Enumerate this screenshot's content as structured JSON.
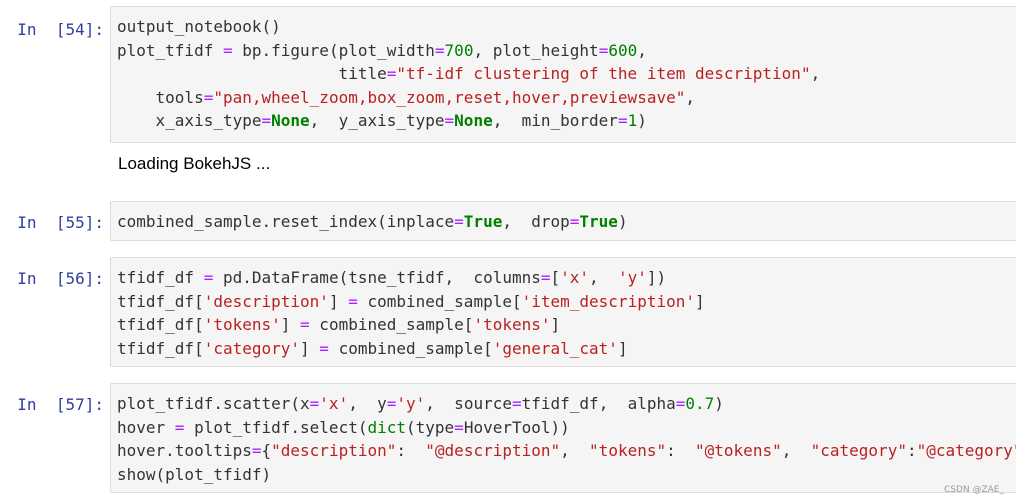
{
  "cells": [
    {
      "prompt": "In  [54]:",
      "lines": [
        [
          {
            "t": "output_notebook()",
            "c": ""
          }
        ],
        [
          {
            "t": "plot_tfidf ",
            "c": ""
          },
          {
            "t": "=",
            "c": "op"
          },
          {
            "t": " bp.figure(plot_width",
            "c": ""
          },
          {
            "t": "=",
            "c": "op"
          },
          {
            "t": "700",
            "c": "num"
          },
          {
            "t": ", plot_height",
            "c": ""
          },
          {
            "t": "=",
            "c": "op"
          },
          {
            "t": "600",
            "c": "num"
          },
          {
            "t": ",",
            "c": ""
          }
        ],
        [
          {
            "t": "                       title",
            "c": ""
          },
          {
            "t": "=",
            "c": "op"
          },
          {
            "t": "\"tf-idf clustering of the item description\"",
            "c": "str"
          },
          {
            "t": ",",
            "c": ""
          }
        ],
        [
          {
            "t": "    tools",
            "c": ""
          },
          {
            "t": "=",
            "c": "op"
          },
          {
            "t": "\"pan,wheel_zoom,box_zoom,reset,hover,previewsave\"",
            "c": "str"
          },
          {
            "t": ",",
            "c": ""
          }
        ],
        [
          {
            "t": "    x_axis_type",
            "c": ""
          },
          {
            "t": "=",
            "c": "op"
          },
          {
            "t": "None",
            "c": "kw"
          },
          {
            "t": ",  y_axis_type",
            "c": ""
          },
          {
            "t": "=",
            "c": "op"
          },
          {
            "t": "None",
            "c": "kw"
          },
          {
            "t": ",  min_border",
            "c": ""
          },
          {
            "t": "=",
            "c": "op"
          },
          {
            "t": "1",
            "c": "num"
          },
          {
            "t": ")",
            "c": ""
          }
        ]
      ],
      "output": "Loading BokehJS ..."
    },
    {
      "prompt": "In  [55]:",
      "lines": [
        [
          {
            "t": "combined_sample.reset_index(inplace",
            "c": ""
          },
          {
            "t": "=",
            "c": "op"
          },
          {
            "t": "True",
            "c": "kw"
          },
          {
            "t": ",  drop",
            "c": ""
          },
          {
            "t": "=",
            "c": "op"
          },
          {
            "t": "True",
            "c": "kw"
          },
          {
            "t": ")",
            "c": ""
          }
        ]
      ]
    },
    {
      "prompt": "In  [56]:",
      "lines": [
        [
          {
            "t": "tfidf_df ",
            "c": ""
          },
          {
            "t": "=",
            "c": "op"
          },
          {
            "t": " pd.DataFrame(tsne_tfidf,  columns",
            "c": ""
          },
          {
            "t": "=",
            "c": "op"
          },
          {
            "t": "[",
            "c": ""
          },
          {
            "t": "'x'",
            "c": "str"
          },
          {
            "t": ",  ",
            "c": ""
          },
          {
            "t": "'y'",
            "c": "str"
          },
          {
            "t": "])",
            "c": ""
          }
        ],
        [
          {
            "t": "tfidf_df[",
            "c": ""
          },
          {
            "t": "'description'",
            "c": "str"
          },
          {
            "t": "] ",
            "c": ""
          },
          {
            "t": "=",
            "c": "op"
          },
          {
            "t": " combined_sample[",
            "c": ""
          },
          {
            "t": "'item_description'",
            "c": "str"
          },
          {
            "t": "]",
            "c": ""
          }
        ],
        [
          {
            "t": "tfidf_df[",
            "c": ""
          },
          {
            "t": "'tokens'",
            "c": "str"
          },
          {
            "t": "] ",
            "c": ""
          },
          {
            "t": "=",
            "c": "op"
          },
          {
            "t": " combined_sample[",
            "c": ""
          },
          {
            "t": "'tokens'",
            "c": "str"
          },
          {
            "t": "]",
            "c": ""
          }
        ],
        [
          {
            "t": "tfidf_df[",
            "c": ""
          },
          {
            "t": "'category'",
            "c": "str"
          },
          {
            "t": "] ",
            "c": ""
          },
          {
            "t": "=",
            "c": "op"
          },
          {
            "t": " combined_sample[",
            "c": ""
          },
          {
            "t": "'general_cat'",
            "c": "str"
          },
          {
            "t": "]",
            "c": ""
          }
        ]
      ]
    },
    {
      "prompt": "In  [57]:",
      "lines": [
        [
          {
            "t": "plot_tfidf.scatter(x",
            "c": ""
          },
          {
            "t": "=",
            "c": "op"
          },
          {
            "t": "'x'",
            "c": "str"
          },
          {
            "t": ",  y",
            "c": ""
          },
          {
            "t": "=",
            "c": "op"
          },
          {
            "t": "'y'",
            "c": "str"
          },
          {
            "t": ",  source",
            "c": ""
          },
          {
            "t": "=",
            "c": "op"
          },
          {
            "t": "tfidf_df,  alpha",
            "c": ""
          },
          {
            "t": "=",
            "c": "op"
          },
          {
            "t": "0.7",
            "c": "num"
          },
          {
            "t": ")",
            "c": ""
          }
        ],
        [
          {
            "t": "hover ",
            "c": ""
          },
          {
            "t": "=",
            "c": "op"
          },
          {
            "t": " plot_tfidf.select(",
            "c": ""
          },
          {
            "t": "dict",
            "c": "num"
          },
          {
            "t": "(type",
            "c": ""
          },
          {
            "t": "=",
            "c": "op"
          },
          {
            "t": "HoverTool))",
            "c": ""
          }
        ],
        [
          {
            "t": "hover.tooltips",
            "c": ""
          },
          {
            "t": "=",
            "c": "op"
          },
          {
            "t": "{",
            "c": ""
          },
          {
            "t": "\"description\"",
            "c": "str"
          },
          {
            "t": ":  ",
            "c": ""
          },
          {
            "t": "\"@description\"",
            "c": "str"
          },
          {
            "t": ",  ",
            "c": ""
          },
          {
            "t": "\"tokens\"",
            "c": "str"
          },
          {
            "t": ":  ",
            "c": ""
          },
          {
            "t": "\"@tokens\"",
            "c": "str"
          },
          {
            "t": ",  ",
            "c": ""
          },
          {
            "t": "\"category\"",
            "c": "str"
          },
          {
            "t": ":",
            "c": ""
          },
          {
            "t": "\"@category\"",
            "c": "str"
          },
          {
            "t": "}",
            "c": ""
          }
        ],
        [
          {
            "t": "show(plot_tfidf)",
            "c": ""
          }
        ]
      ]
    }
  ],
  "watermark": "CSDN @ZAE_"
}
